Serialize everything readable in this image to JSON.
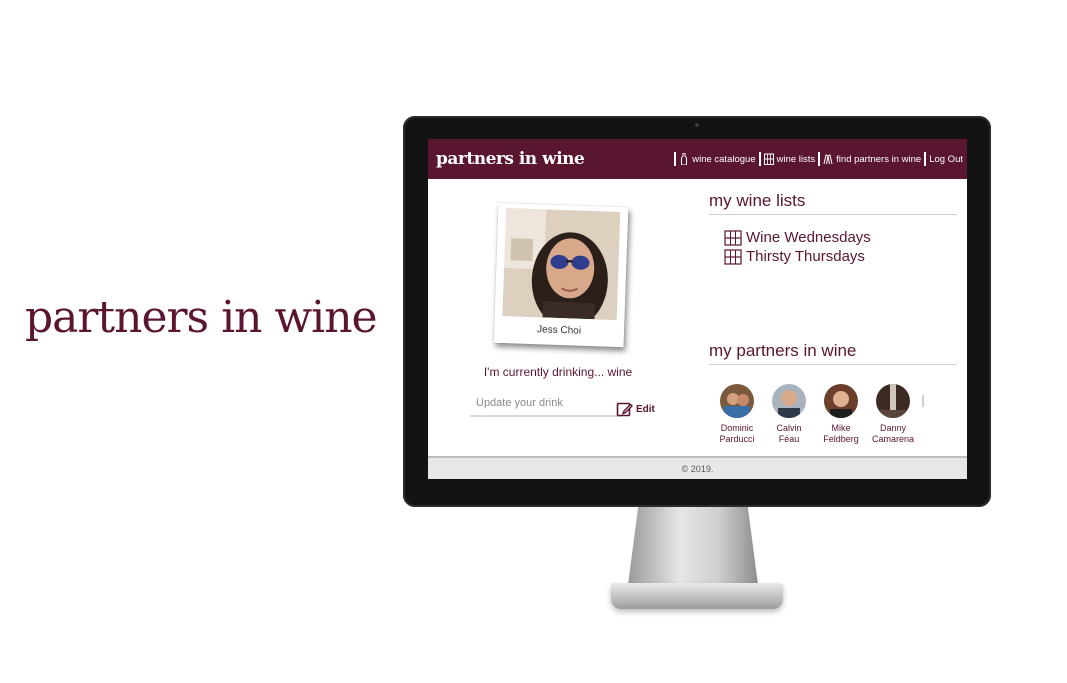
{
  "hero": {
    "title": "partners in wine"
  },
  "app": {
    "brand": "partners in wine",
    "nav": [
      {
        "label": "wine catalogue",
        "icon": "wine-bottle-icon"
      },
      {
        "label": "wine lists",
        "icon": "wine-rack-icon"
      },
      {
        "label": "find partners in wine",
        "icon": "toast-glasses-icon"
      },
      {
        "label": "Log Out",
        "icon": ""
      }
    ]
  },
  "profile": {
    "name": "Jess Choi",
    "drinking_text": "I'm currently drinking... wine",
    "drink_placeholder": "Update your drink",
    "edit_label": "Edit"
  },
  "wine_lists": {
    "title": "my wine lists",
    "items": [
      "Wine Wednesdays",
      "Thirsty Thursdays"
    ]
  },
  "partners": {
    "title": "my partners in wine",
    "people": [
      {
        "first": "Dominic",
        "last": "Parducci"
      },
      {
        "first": "Calvin",
        "last": "Féau"
      },
      {
        "first": "Mike",
        "last": "Feldberg"
      },
      {
        "first": "Danny",
        "last": "Camarena"
      }
    ]
  },
  "footer": {
    "text": "© 2019."
  },
  "colors": {
    "brand": "#5a1530",
    "footer_bg": "#e8e8e8"
  }
}
